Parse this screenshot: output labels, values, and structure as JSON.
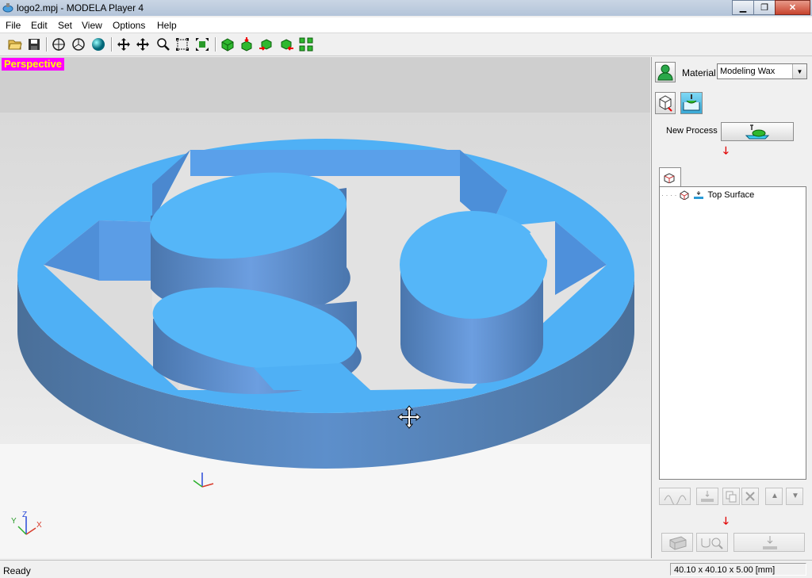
{
  "window": {
    "title": "logo2.mpj - MODELA Player 4"
  },
  "menu": [
    "File",
    "Edit",
    "Set",
    "View",
    "Options",
    "Help"
  ],
  "viewport": {
    "view_label": "Perspective"
  },
  "axes": {
    "y": "Y",
    "z": "Z",
    "x": "X"
  },
  "panel": {
    "material_label": "Material",
    "material_value": "Modeling Wax",
    "new_process_label": "New Process",
    "tree_item": "Top Surface"
  },
  "status": {
    "text": "Ready",
    "dimensions": "40.10 x 40.10 x 5.00 [mm]"
  },
  "colors": {
    "model": "#4fb0f5",
    "label_bg": "#ff00ff",
    "label_fg": "#ffff00"
  }
}
